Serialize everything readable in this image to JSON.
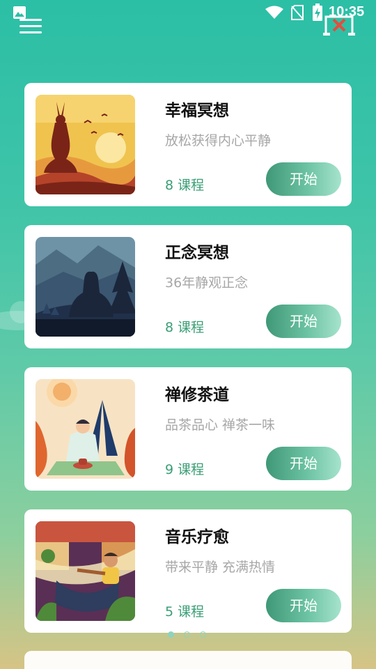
{
  "status_bar": {
    "time": "10:35",
    "icons": [
      "gallery-icon",
      "wifi-icon",
      "no-sim-icon",
      "battery-charging-icon"
    ]
  },
  "header": {
    "menu_icon": "hamburger-menu-icon",
    "cast_icon": "screen-cast-off-icon",
    "accent_color": "#e74c3c"
  },
  "courses": [
    {
      "title": "幸福冥想",
      "subtitle": "放松获得内心平静",
      "count": "8 课程",
      "button": "开始",
      "image": "yoga-sunset-icon"
    },
    {
      "title": "正念冥想",
      "subtitle": "36年静观正念",
      "count": "8 课程",
      "button": "开始",
      "image": "buddha-mountains-icon"
    },
    {
      "title": "禅修茶道",
      "subtitle": "品茶品心 禅茶一味",
      "count": "9 课程",
      "button": "开始",
      "image": "tea-ceremony-icon"
    },
    {
      "title": "音乐疗愈",
      "subtitle": "带来平静 充满热情",
      "count": "5 课程",
      "button": "开始",
      "image": "music-hammock-icon"
    }
  ],
  "pager": {
    "pages": 3,
    "active": 1
  },
  "colors": {
    "background_top": "#2bbfa6",
    "background_bottom": "#d6c485",
    "count_text": "#3a9e76",
    "button_start": "#3f9877",
    "button_end": "#a6e3cd"
  }
}
